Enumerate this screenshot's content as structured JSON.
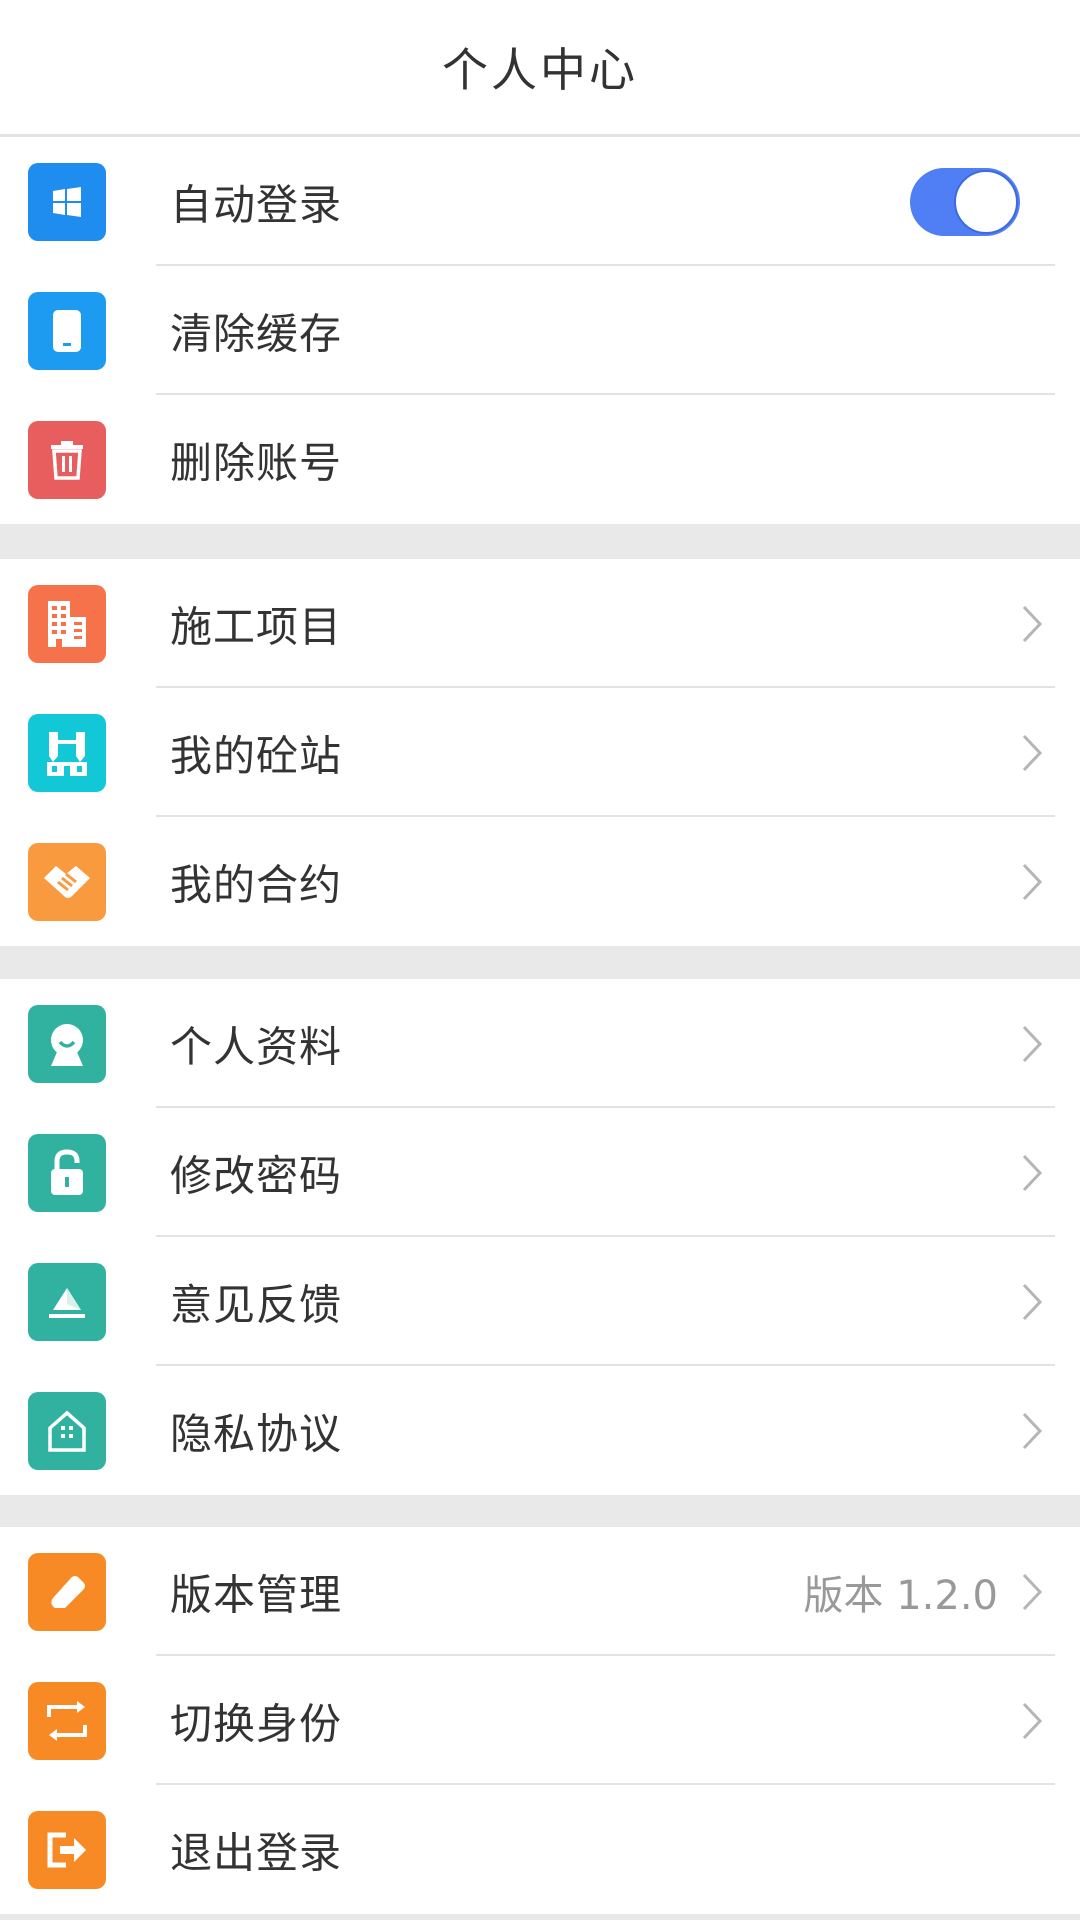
{
  "header": {
    "title": "个人中心"
  },
  "colors": {
    "toggle_on": "#4f7ef5",
    "blue": "#1f8cef",
    "red": "#e85d5d",
    "orange_red": "#f5724a",
    "cyan": "#12c8d6",
    "orange": "#f99a3f",
    "teal": "#31b2a0",
    "dark_orange": "#f88a25"
  },
  "settings": {
    "items": [
      {
        "label": "自动登录",
        "icon": "windows-icon",
        "toggle_on": true
      },
      {
        "label": "清除缓存",
        "icon": "phone-icon"
      },
      {
        "label": "删除账号",
        "icon": "trash-icon"
      }
    ]
  },
  "business": {
    "items": [
      {
        "label": "施工项目",
        "icon": "building-icon"
      },
      {
        "label": "我的砼站",
        "icon": "factory-icon"
      },
      {
        "label": "我的合约",
        "icon": "handshake-icon"
      }
    ]
  },
  "account": {
    "items": [
      {
        "label": "个人资料",
        "icon": "profile-icon"
      },
      {
        "label": "修改密码",
        "icon": "lock-icon"
      },
      {
        "label": "意见反馈",
        "icon": "feedback-icon"
      },
      {
        "label": "隐私协议",
        "icon": "house-icon"
      }
    ]
  },
  "system": {
    "items": [
      {
        "label": "版本管理",
        "icon": "eraser-icon",
        "value": "版本 1.2.0"
      },
      {
        "label": "切换身份",
        "icon": "switch-icon"
      },
      {
        "label": "退出登录",
        "icon": "logout-icon"
      }
    ]
  }
}
